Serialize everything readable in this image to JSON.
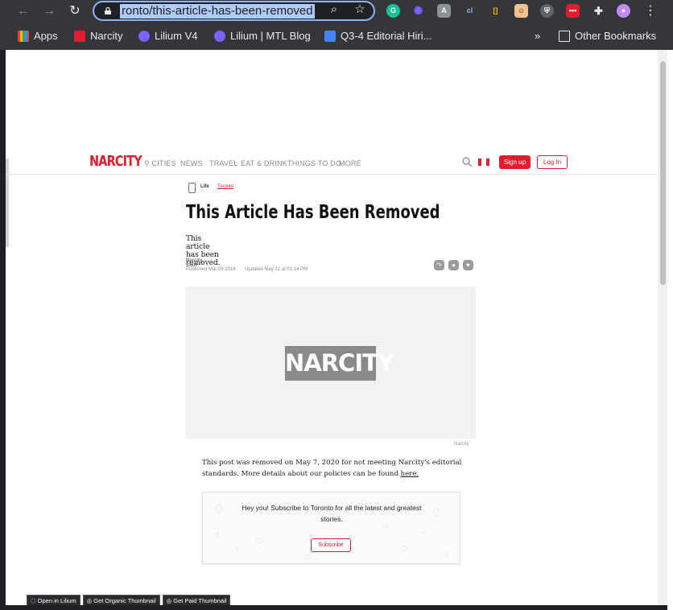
{
  "browser": {
    "url": "ronto/this-article-has-been-removed",
    "bookmarks": [
      {
        "label": "Apps",
        "color": "#ea4335"
      },
      {
        "label": "Narcity",
        "color": "#e31d2f"
      },
      {
        "label": "Lilium V4",
        "color": "#7b61ff"
      },
      {
        "label": "Lilium | MTL Blog",
        "color": "#7b61ff"
      },
      {
        "label": "Q3-4 Editorial Hiri...",
        "color": "#4285f4"
      },
      {
        "label": "»",
        "color": ""
      },
      {
        "label": "Other Bookmarks",
        "color": ""
      }
    ]
  },
  "site": {
    "logo": "NARCITY",
    "nav": [
      "CITIES",
      "NEWS",
      "TRAVEL",
      "EAT & DRINK",
      "THINGS TO DO",
      "MORE"
    ],
    "signup": "Sign up",
    "login": "Log In",
    "accent": "#e31d2f"
  },
  "article": {
    "category": "Life",
    "city": "Toronto",
    "headline": "This Article Has Been Removed",
    "dek": "This article has been removed.",
    "author": "Narcity Staff",
    "published": "Published Mar 09 2016",
    "updated": "Updated May 22 at 01:14 PM",
    "separator": "·",
    "hero_logo": "NARCITY",
    "credit": "Narcity",
    "notice_text": "This post was removed on May 7, 2020 for not meeting Narcity's editorial standards. More details about our policies can be found ",
    "notice_link": "here."
  },
  "subscribe": {
    "text": "Hey you! Subscribe to Toronto for all the latest and greatest stories.",
    "button": "Subscribe"
  },
  "lilium_tools": [
    "Open in Lilium",
    "Get Organic Thumbnail",
    "Get Paid Thumbnail"
  ]
}
